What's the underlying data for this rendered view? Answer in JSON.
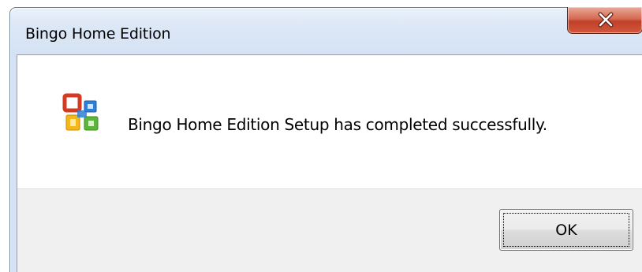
{
  "window": {
    "title": "Bingo Home Edition"
  },
  "title_bar": {
    "close_icon": "close-x-icon"
  },
  "dialog": {
    "icon": "office-setup-icon",
    "message": "Bingo Home Edition Setup has completed successfully."
  },
  "buttons": {
    "ok_label": "OK"
  },
  "colors": {
    "close_button": "#c94a30",
    "footer_bg": "#f0f0f0",
    "frame": "#d4e2f3"
  }
}
